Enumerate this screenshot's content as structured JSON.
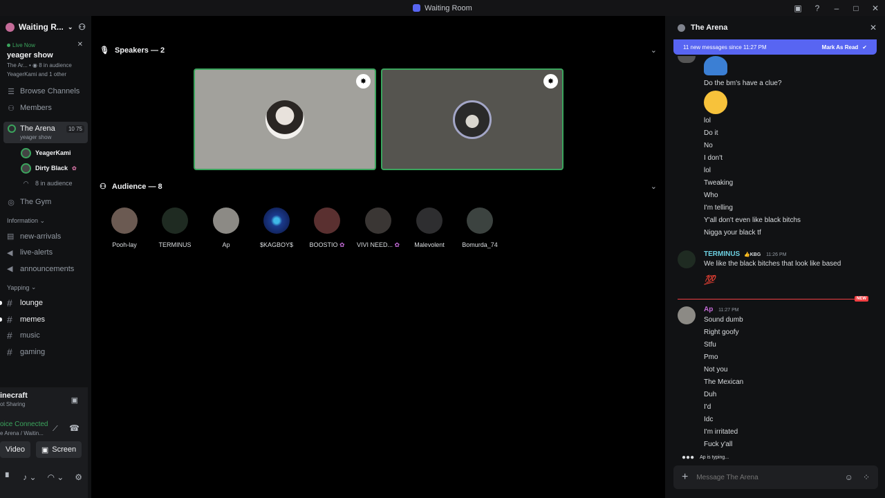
{
  "window": {
    "title": "Waiting Room"
  },
  "sidebar": {
    "server_name": "Waiting R...",
    "live": {
      "label": "Live Now",
      "title": "yeager show",
      "meta1": "The Ar...",
      "meta1_count": "8 in audience",
      "meta2": "YeagerKami and 1 other"
    },
    "nav": [
      {
        "label": "Browse Channels"
      },
      {
        "label": "Members"
      }
    ],
    "stage_channel": {
      "name": "The Arena",
      "counts": "10 75",
      "subtitle": "yeager show"
    },
    "speakers": [
      {
        "name": "YeagerKami"
      },
      {
        "name": "Dirty Black"
      }
    ],
    "audience_count": "8 in audience",
    "gym": "The Gym",
    "categories": [
      {
        "name": "Information",
        "channels": [
          "new-arrivals",
          "live-alerts",
          "announcements"
        ]
      },
      {
        "name": "Yapping",
        "channels": [
          "lounge",
          "memes",
          "music",
          "gaming"
        ]
      }
    ],
    "voice_panel": {
      "activity": "inecraft",
      "activity_sub": "ot Sharing",
      "status": "oice Connected",
      "status_sub": "e Arena / Waitin...",
      "video_label": "Video",
      "screen_label": "Screen"
    }
  },
  "stage": {
    "speakers_header": "Speakers — 2",
    "audience_header": "Audience — 8",
    "audience": [
      {
        "name": "Pooh-lay",
        "color": "#6b5a52"
      },
      {
        "name": "TERMINUS",
        "color": "#1f2b22"
      },
      {
        "name": "Ap",
        "color": "#8c8a85"
      },
      {
        "name": "$KAGBOY$",
        "color": "#1b3a8c"
      },
      {
        "name": "BOOSTIO",
        "color": "#5a3030"
      },
      {
        "name": "VIVI NEED...",
        "color": "#3a3634"
      },
      {
        "name": "Malevolent",
        "color": "#2e2e30"
      },
      {
        "name": "Bomurda_74",
        "color": "#3c4340"
      }
    ]
  },
  "chat": {
    "title": "The Arena",
    "new_banner": "11 new messages since 11:27 PM",
    "mark_read": "Mark As Read",
    "top_messages": [
      "Do the bm's have a clue?",
      "lol",
      "Do it",
      "No",
      "I don't",
      "lol",
      "Tweaking",
      "Who",
      "I'm telling",
      "Y'all don't even like black bitchs",
      "Nigga your black tf"
    ],
    "terminus": {
      "name": "TERMINUS",
      "tag": "KBG",
      "time": "11:26 PM",
      "text": "We like the black bitches that look like based"
    },
    "new_tag": "NEW",
    "ap": {
      "name": "Ap",
      "time": "11:27 PM",
      "messages": [
        "Sound dumb",
        "Right goofy",
        "Stfu",
        "Pmo",
        "Not you",
        "The Mexican",
        "Duh",
        "I'd",
        "Idc",
        "I'm irritated",
        "Fuck y'all"
      ]
    },
    "typing": "Ap is typing...",
    "placeholder": "Message The Arena"
  }
}
